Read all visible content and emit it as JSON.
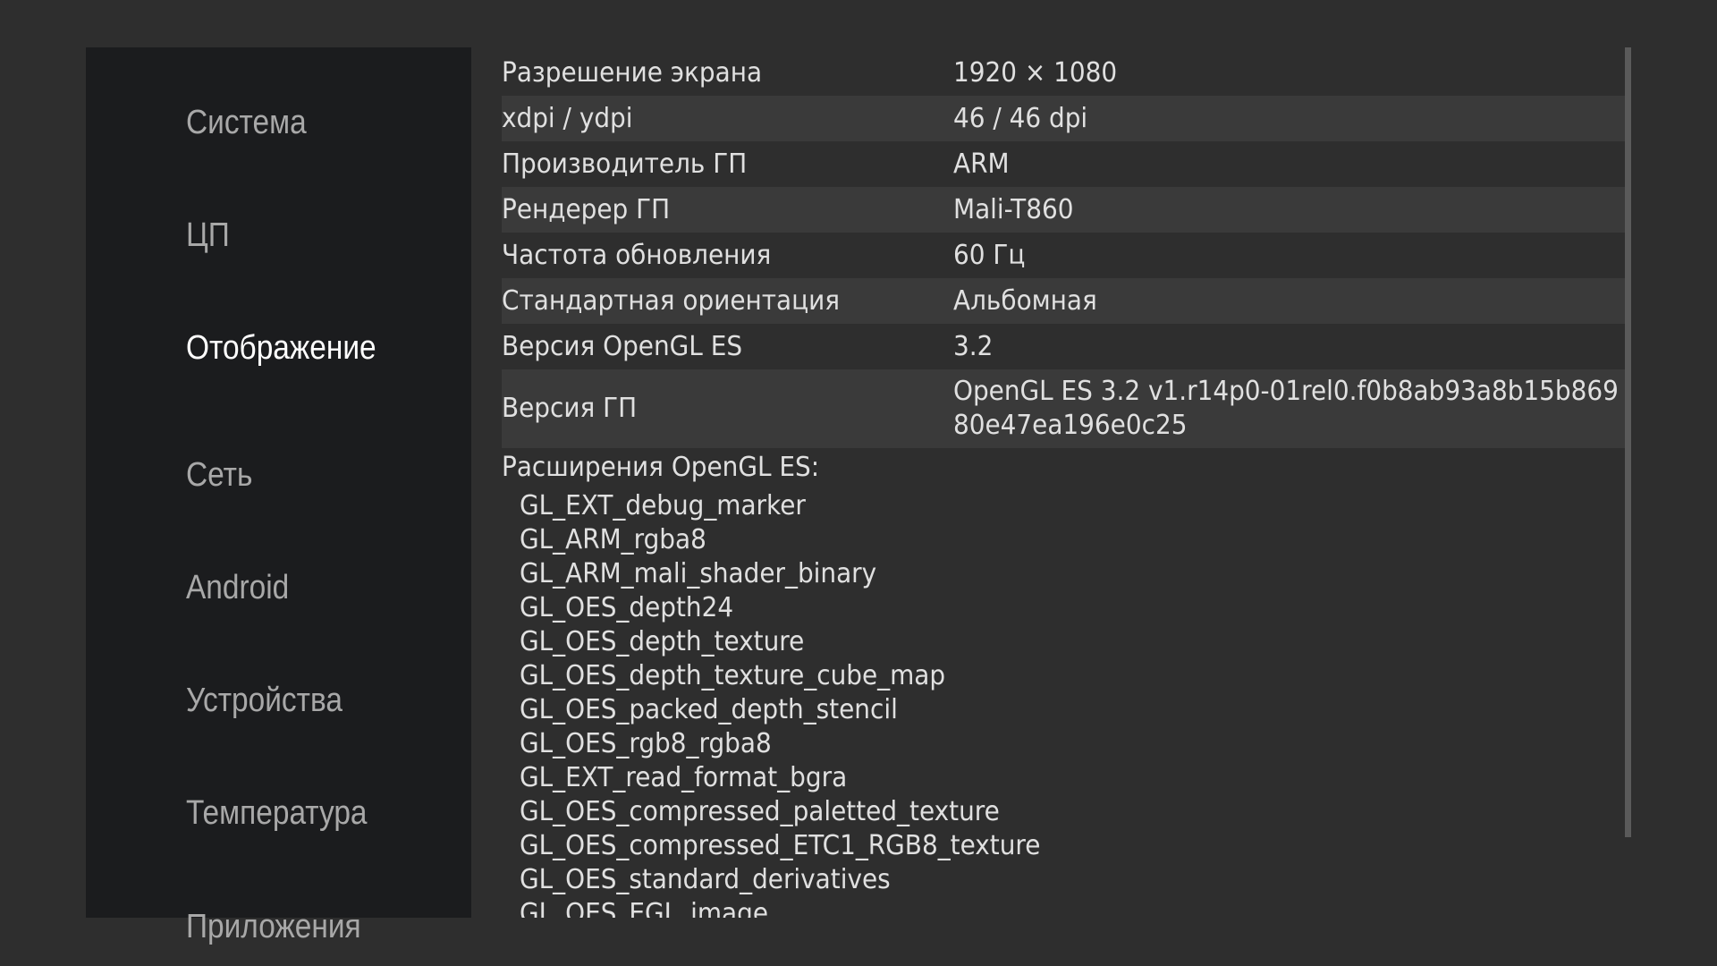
{
  "sidebar": {
    "items": [
      {
        "label": "Система",
        "active": false
      },
      {
        "label": "ЦП",
        "active": false
      },
      {
        "label": "Отображение",
        "active": true
      },
      {
        "label": "Сеть",
        "active": false
      },
      {
        "label": "Android",
        "active": false
      },
      {
        "label": "Устройства",
        "active": false
      },
      {
        "label": "Температура",
        "active": false
      },
      {
        "label": "Приложения",
        "active": false
      }
    ]
  },
  "display": {
    "rows": [
      {
        "label": "Разрешение экрана",
        "value": "1920 × 1080"
      },
      {
        "label": "xdpi / ydpi",
        "value": "46 / 46 dpi"
      },
      {
        "label": "Производитель ГП",
        "value": "ARM"
      },
      {
        "label": "Рендерер ГП",
        "value": "Mali-T860"
      },
      {
        "label": "Частота обновления",
        "value": "60 Гц"
      },
      {
        "label": "Стандартная ориентация",
        "value": "Альбомная"
      },
      {
        "label": "Версия OpenGL ES",
        "value": "3.2"
      }
    ],
    "gpu_version": {
      "label": "Версия ГП",
      "value_line1": "OpenGL ES 3.2 v1.r14p0-01rel0.f0b8ab93a8b15b869",
      "value_line2": "80e47ea196e0c25"
    },
    "extensions_title": "Расширения OpenGL ES:",
    "extensions": [
      "GL_EXT_debug_marker",
      "GL_ARM_rgba8",
      "GL_ARM_mali_shader_binary",
      "GL_OES_depth24",
      "GL_OES_depth_texture",
      "GL_OES_depth_texture_cube_map",
      "GL_OES_packed_depth_stencil",
      "GL_OES_rgb8_rgba8",
      "GL_EXT_read_format_bgra",
      "GL_OES_compressed_paletted_texture",
      "GL_OES_compressed_ETC1_RGB8_texture",
      "GL_OES_standard_derivatives",
      "GL_OES_EGL_image"
    ]
  },
  "colors": {
    "background": "#2e2e2e",
    "sidebar": "#1b1c1e",
    "row_shade": "#3a3a3a",
    "active_text": "#ffffff",
    "inactive_text": "#a8a8a8"
  }
}
